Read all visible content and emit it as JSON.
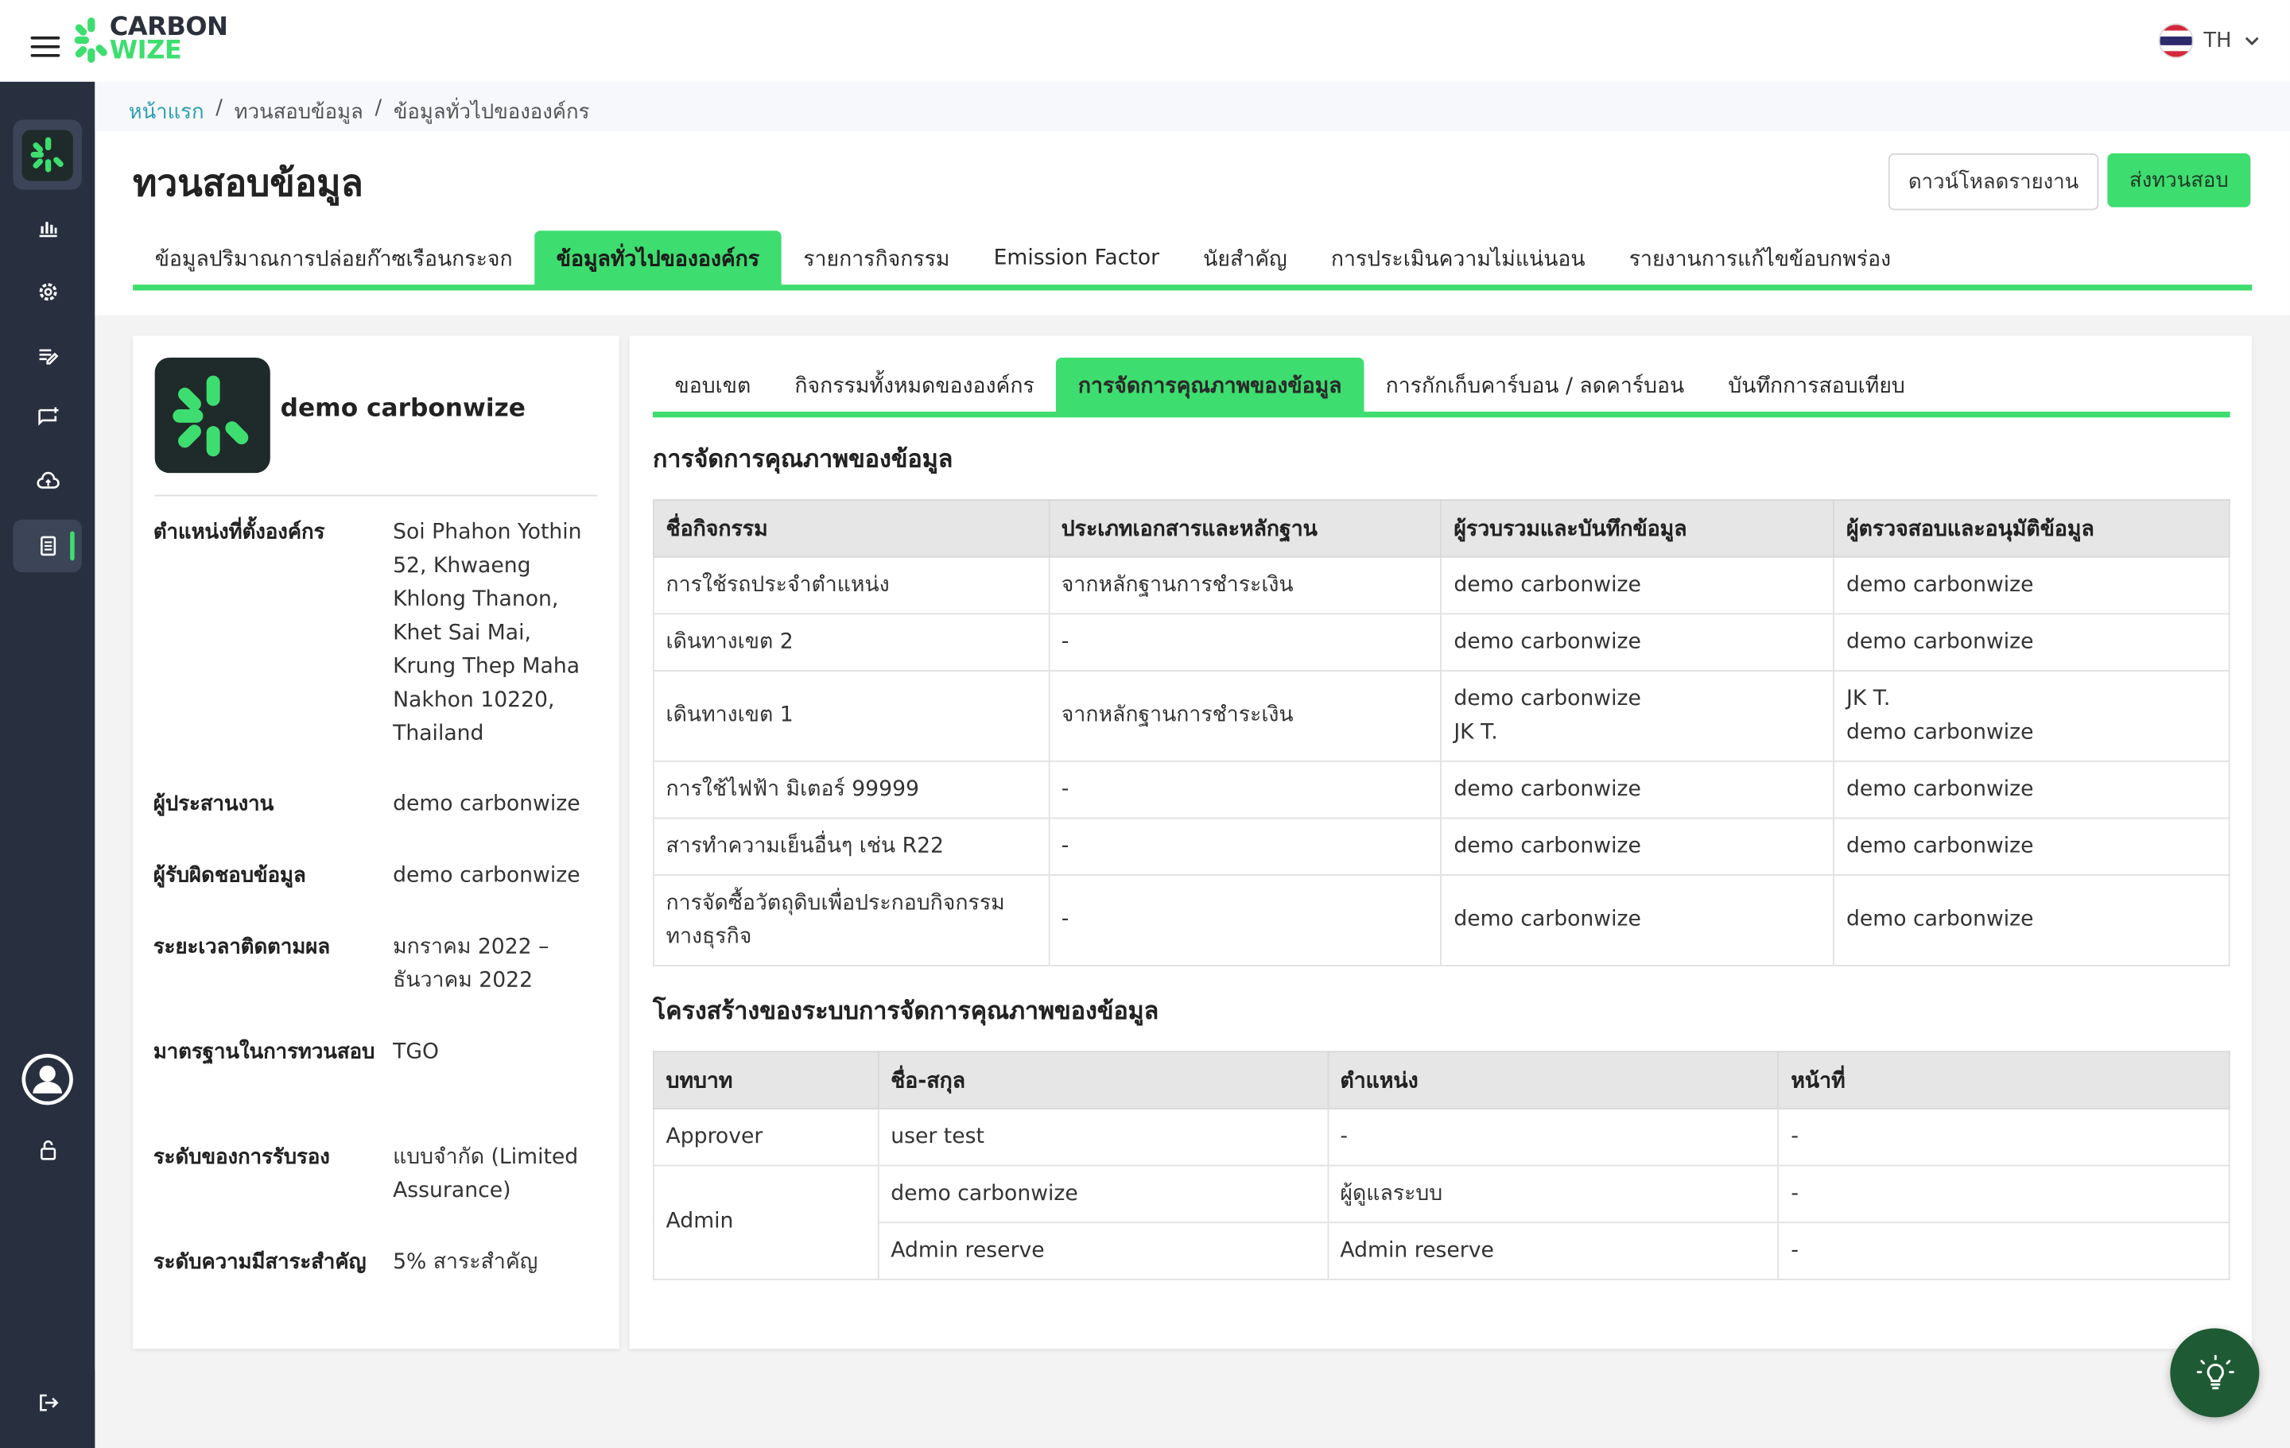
{
  "brand": {
    "line1": "CARBON",
    "line2": "WIZE",
    "accent": "#3dde6f",
    "dark": "#283040"
  },
  "language": {
    "code": "TH"
  },
  "breadcrumb": {
    "home": "หน้าแรก",
    "sep": "/",
    "level2": "ทวนสอบข้อมูล",
    "level3": "ข้อมูลทั่วไปขององค์กร"
  },
  "page": {
    "title": "ทวนสอบข้อมูล",
    "download_button": "ดาวน์โหลดรายงาน",
    "submit_button": "ส่งทวนสอบ"
  },
  "main_tabs": [
    {
      "label": "ข้อมูลปริมาณการปล่อยก๊าซเรือนกระจก",
      "active": false
    },
    {
      "label": "ข้อมูลทั่วไปขององค์กร",
      "active": true
    },
    {
      "label": "รายการกิจกรรม",
      "active": false
    },
    {
      "label": "Emission Factor",
      "active": false
    },
    {
      "label": "นัยสำคัญ",
      "active": false
    },
    {
      "label": "การประเมินความไม่แน่นอน",
      "active": false
    },
    {
      "label": "รายงานการแก้ไขข้อบกพร่อง",
      "active": false
    }
  ],
  "organization": {
    "name": "demo carbonwize",
    "fields": [
      {
        "label": "ตำแหน่งที่ตั้งองค์กร",
        "value": "Soi Phahon Yothin 52, Khwaeng Khlong Thanon, Khet Sai Mai, Krung Thep Maha Nakhon 10220, Thailand"
      },
      {
        "label": "ผู้ประสานงาน",
        "value": "demo carbonwize"
      },
      {
        "label": "ผู้รับผิดชอบข้อมูล",
        "value": "demo carbonwize"
      },
      {
        "label": "ระยะเวลาติดตามผล",
        "value": "มกราคม 2022 – ธันวาคม 2022"
      },
      {
        "label": "มาตรฐานในการทวนสอบ",
        "value": "TGO"
      },
      {
        "label": "ระดับของการรับรอง",
        "value": "แบบจำกัด (Limited Assurance)"
      },
      {
        "label": "ระดับความมีสาระสำคัญ",
        "value": "5% สาระสำคัญ"
      }
    ]
  },
  "sub_tabs": [
    {
      "label": "ขอบเขต",
      "active": false
    },
    {
      "label": "กิจกรรมทั้งหมดขององค์กร",
      "active": false
    },
    {
      "label": "การจัดการคุณภาพของข้อมูล",
      "active": true
    },
    {
      "label": "การกักเก็บคาร์บอน / ลดคาร์บอน",
      "active": false
    },
    {
      "label": "บันทึกการสอบเทียบ",
      "active": false
    }
  ],
  "quality_section": {
    "title": "การจัดการคุณภาพของข้อมูล",
    "columns": [
      "ชื่อกิจกรรม",
      "ประเภทเอกสารและหลักฐาน",
      "ผู้รวบรวมและบันทึกข้อมูล",
      "ผู้ตรวจสอบและอนุมัติข้อมูล"
    ],
    "rows": [
      {
        "activity": "การใช้รถประจำตำแหน่ง",
        "evidence": "จากหลักฐานการชำระเงิน",
        "collector": [
          "demo carbonwize"
        ],
        "approver": [
          "demo carbonwize"
        ]
      },
      {
        "activity": "เดินทางเขต 2",
        "evidence": "-",
        "collector": [
          "demo carbonwize"
        ],
        "approver": [
          "demo carbonwize"
        ]
      },
      {
        "activity": "เดินทางเขต 1",
        "evidence": "จากหลักฐานการชำระเงิน",
        "collector": [
          "demo carbonwize",
          "JK T."
        ],
        "approver": [
          "JK T.",
          "demo carbonwize"
        ]
      },
      {
        "activity": "การใช้ไฟฟ้า มิเตอร์ 99999",
        "evidence": "-",
        "collector": [
          "demo carbonwize"
        ],
        "approver": [
          "demo carbonwize"
        ]
      },
      {
        "activity": "สารทำความเย็นอื่นๆ เช่น R22",
        "evidence": "-",
        "collector": [
          "demo carbonwize"
        ],
        "approver": [
          "demo carbonwize"
        ]
      },
      {
        "activity": "การจัดซื้อวัตถุดิบเพื่อประกอบกิจกรรมทางธุรกิจ",
        "evidence": "-",
        "collector": [
          "demo carbonwize"
        ],
        "approver": [
          "demo carbonwize"
        ]
      }
    ]
  },
  "structure_section": {
    "title": "โครงสร้างของระบบการจัดการคุณภาพของข้อมูล",
    "columns": [
      "บทบาท",
      "ชื่อ-สกุล",
      "ตำแหน่ง",
      "หน้าที่"
    ],
    "groups": [
      {
        "role": "Approver",
        "members": [
          {
            "name": "user test",
            "position": "-",
            "duty": "-"
          }
        ]
      },
      {
        "role": "Admin",
        "members": [
          {
            "name": "demo carbonwize",
            "position": "ผู้ดูแลระบบ",
            "duty": "-"
          },
          {
            "name": "Admin reserve",
            "position": "Admin reserve",
            "duty": "-"
          }
        ]
      }
    ]
  }
}
